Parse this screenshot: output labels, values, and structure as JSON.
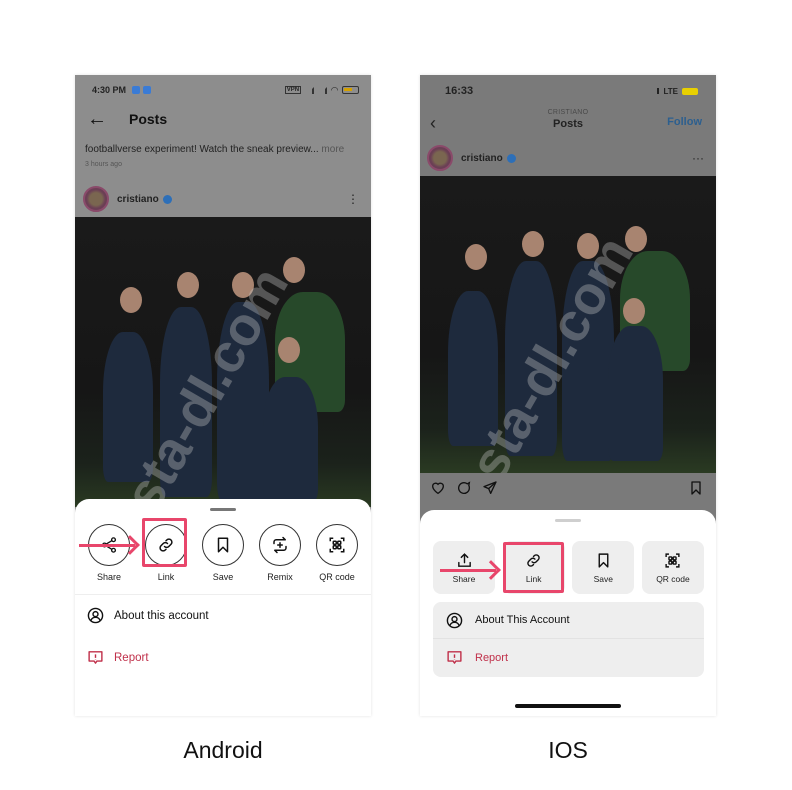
{
  "android": {
    "status_time": "4:30 PM",
    "status_vpn": "VPN",
    "header_title": "Posts",
    "caption_text": "footballverse experiment! Watch the sneak preview...",
    "caption_more": "more",
    "post_time": "3 hours ago",
    "username": "cristiano",
    "watermark": "insta-dl.com",
    "share_actions": [
      {
        "label": "Share",
        "icon": "share-icon"
      },
      {
        "label": "Link",
        "icon": "link-icon"
      },
      {
        "label": "Save",
        "icon": "bookmark-icon"
      },
      {
        "label": "Remix",
        "icon": "remix-icon"
      },
      {
        "label": "QR code",
        "icon": "qr-code-icon"
      }
    ],
    "menu": [
      {
        "label": "About this account",
        "icon": "user-circle-icon"
      },
      {
        "label": "Report",
        "icon": "report-icon"
      }
    ],
    "highlighted_action": "Link",
    "caption_label": "Android"
  },
  "ios": {
    "status_time": "16:33",
    "status_network": "LTE",
    "header_subtitle": "CRISTIANO",
    "header_title": "Posts",
    "follow_label": "Follow",
    "username": "cristiano",
    "watermark": "insta-dl.com",
    "share_actions": [
      {
        "label": "Share",
        "icon": "share-icon"
      },
      {
        "label": "Link",
        "icon": "link-icon"
      },
      {
        "label": "Save",
        "icon": "bookmark-icon"
      },
      {
        "label": "QR code",
        "icon": "qr-code-icon"
      }
    ],
    "menu": [
      {
        "label": "About This Account",
        "icon": "user-circle-icon"
      },
      {
        "label": "Report",
        "icon": "report-icon"
      }
    ],
    "highlighted_action": "Link",
    "caption_label": "IOS"
  },
  "colors": {
    "highlight": "#e8466b",
    "report": "#c0304a",
    "follow": "#2c5f8f",
    "verified": "#2d6fb8"
  }
}
